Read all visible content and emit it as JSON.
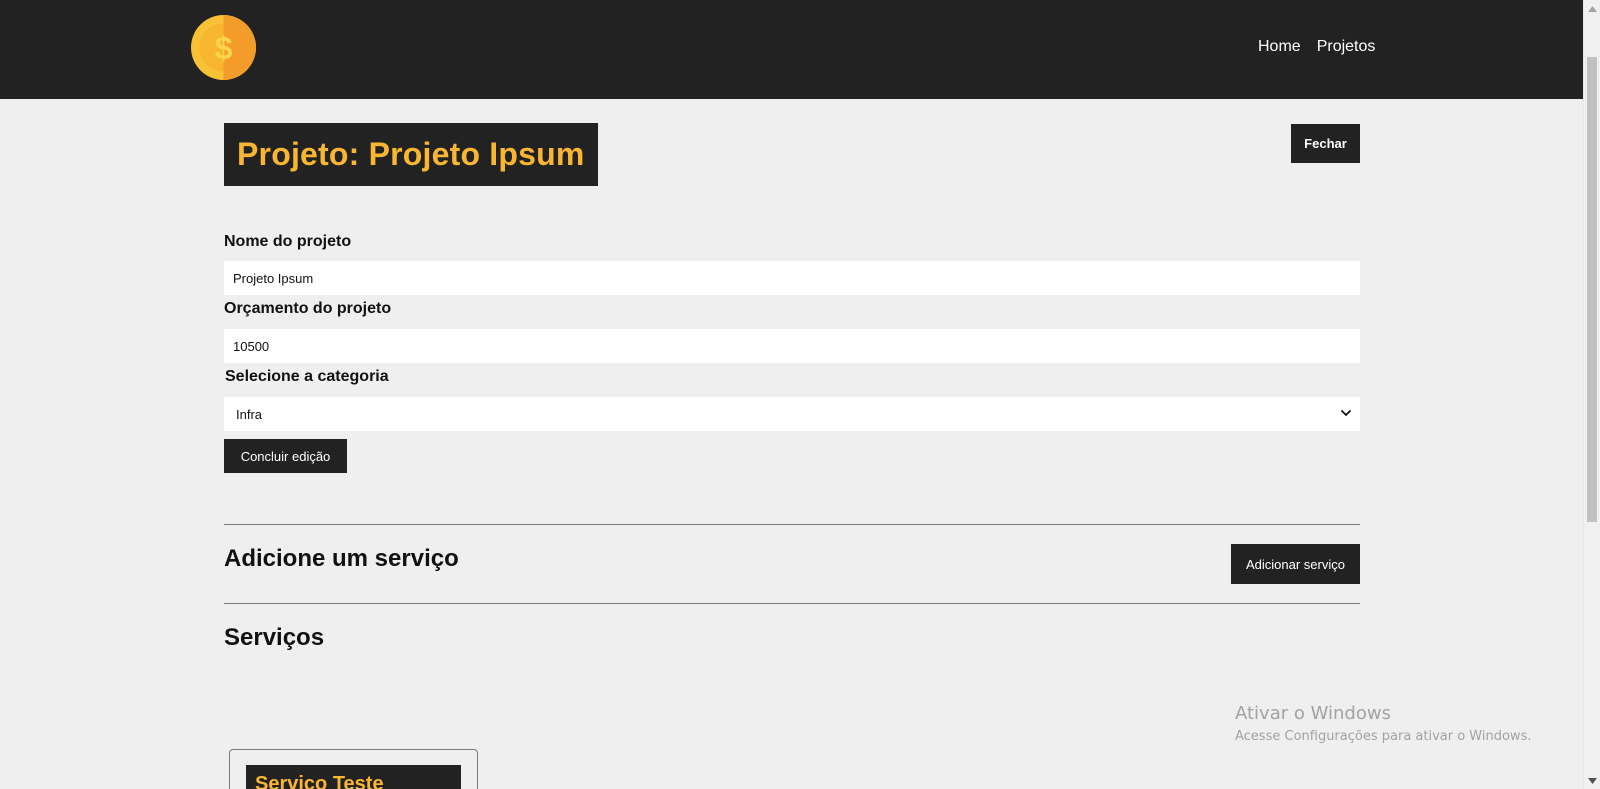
{
  "navbar": {
    "logo_icon": "coin-dollar-icon",
    "links": [
      "Home",
      "Projetos"
    ]
  },
  "project": {
    "title": "Projeto: Projeto Ipsum",
    "close_label": "Fechar"
  },
  "form": {
    "name_label": "Nome do projeto",
    "name_value": "Projeto Ipsum",
    "budget_label": "Orçamento do projeto",
    "budget_value": "10500",
    "category_label": "Selecione a categoria",
    "category_value": "Infra",
    "submit_label": "Concluir edição"
  },
  "services": {
    "add_title": "Adicione um serviço",
    "add_button": "Adicionar serviço",
    "list_title": "Serviços",
    "cards": [
      {
        "name": "Serviço Teste"
      }
    ]
  },
  "watermark": {
    "line1": "Ativar o Windows",
    "line2": "Acesse Configurações para ativar o Windows."
  },
  "colors": {
    "dark": "#222222",
    "accent": "#fbb631",
    "background": "#efefef"
  }
}
